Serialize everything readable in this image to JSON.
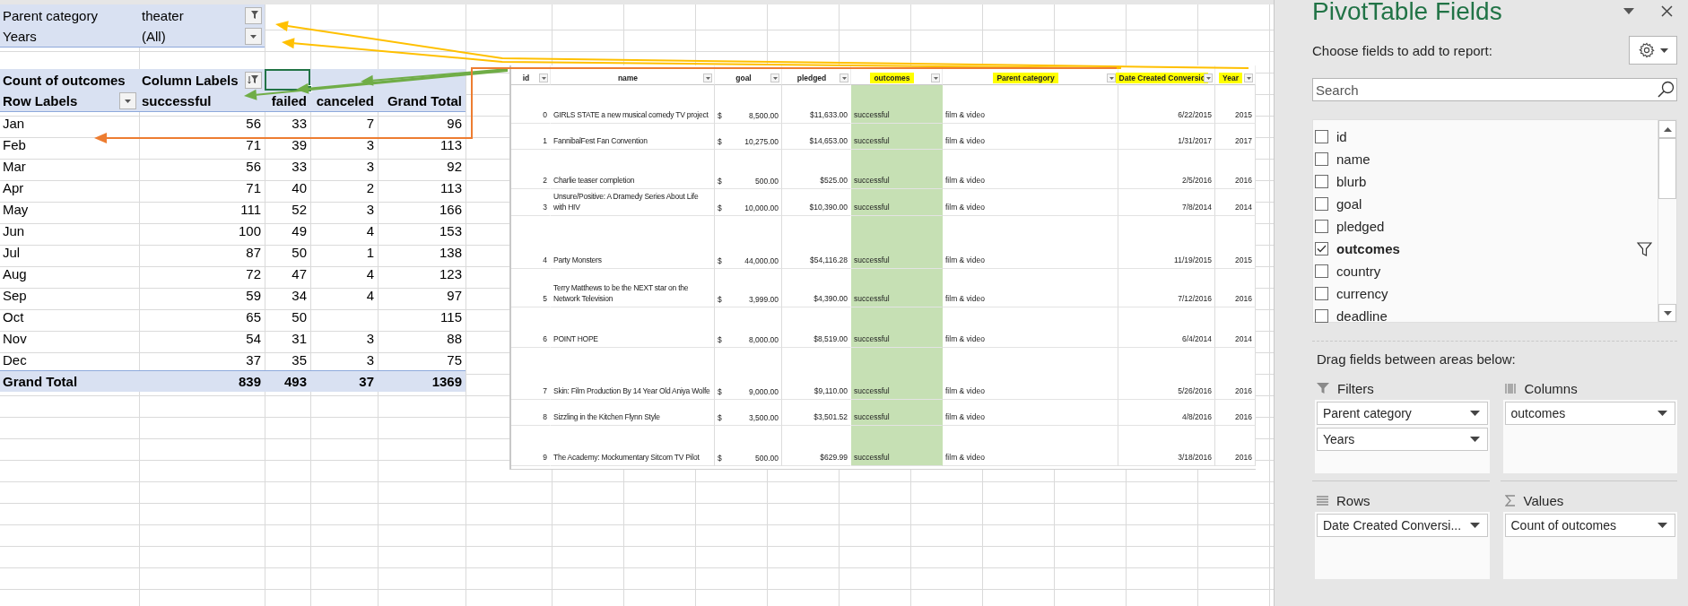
{
  "pivot": {
    "filters": [
      {
        "label": "Parent category",
        "value": "theater",
        "filtered": true
      },
      {
        "label": "Years",
        "value": "(All)",
        "filtered": false
      }
    ],
    "values_label": "Count of outcomes",
    "columns_label": "Column Labels",
    "columns_filtered": true,
    "row_labels": "Row Labels",
    "columns": [
      "successful",
      "failed",
      "canceled",
      "Grand Total"
    ],
    "rows": [
      {
        "label": "Jan",
        "successful": "56",
        "failed": "33",
        "canceled": "7",
        "grand_total": "96"
      },
      {
        "label": "Feb",
        "successful": "71",
        "failed": "39",
        "canceled": "3",
        "grand_total": "113"
      },
      {
        "label": "Mar",
        "successful": "56",
        "failed": "33",
        "canceled": "3",
        "grand_total": "92"
      },
      {
        "label": "Apr",
        "successful": "71",
        "failed": "40",
        "canceled": "2",
        "grand_total": "113"
      },
      {
        "label": "May",
        "successful": "111",
        "failed": "52",
        "canceled": "3",
        "grand_total": "166"
      },
      {
        "label": "Jun",
        "successful": "100",
        "failed": "49",
        "canceled": "4",
        "grand_total": "153"
      },
      {
        "label": "Jul",
        "successful": "87",
        "failed": "50",
        "canceled": "1",
        "grand_total": "138"
      },
      {
        "label": "Aug",
        "successful": "72",
        "failed": "47",
        "canceled": "4",
        "grand_total": "123"
      },
      {
        "label": "Sep",
        "successful": "59",
        "failed": "34",
        "canceled": "4",
        "grand_total": "97"
      },
      {
        "label": "Oct",
        "successful": "65",
        "failed": "50",
        "grand_total": "115"
      },
      {
        "label": "Nov",
        "successful": "54",
        "failed": "31",
        "canceled": "3",
        "grand_total": "88"
      },
      {
        "label": "Dec",
        "successful": "37",
        "failed": "35",
        "canceled": "3",
        "grand_total": "75"
      }
    ],
    "grand_total": {
      "label": "Grand Total",
      "successful": "839",
      "failed": "493",
      "canceled": "37",
      "grand_total": "1369"
    }
  },
  "source_table": {
    "columns": [
      {
        "label": "id",
        "highlighted": false
      },
      {
        "label": "name",
        "highlighted": false
      },
      {
        "label": "goal",
        "highlighted": false
      },
      {
        "label": "pledged",
        "highlighted": false
      },
      {
        "label": "outcomes",
        "highlighted": true
      },
      {
        "label": "Parent category",
        "highlighted": true
      },
      {
        "label": "Date Created Conversic",
        "highlighted": true
      },
      {
        "label": "Year",
        "highlighted": true
      }
    ],
    "rows": [
      {
        "id": "0",
        "name": "GIRLS STATE a new musical comedy TV project",
        "currency": "$",
        "goal": "8,500.00",
        "pledged": "$11,633.00",
        "outcome": "successful",
        "parent_category": "film & video",
        "date": "6/22/2015",
        "year": "2015"
      },
      {
        "id": "1",
        "name": "FannibalFest Fan Convention",
        "currency": "$",
        "goal": "10,275.00",
        "pledged": "$14,653.00",
        "outcome": "successful",
        "parent_category": "film & video",
        "date": "1/31/2017",
        "year": "2017"
      },
      {
        "id": "2",
        "name": "Charlie teaser completion",
        "currency": "$",
        "goal": "500.00",
        "pledged": "$525.00",
        "outcome": "successful",
        "parent_category": "film & video",
        "date": "2/5/2016",
        "year": "2016"
      },
      {
        "id": "3",
        "name": "Unsure/Positive: A Dramedy Series About Life with HIV",
        "currency": "$",
        "goal": "10,000.00",
        "pledged": "$10,390.00",
        "outcome": "successful",
        "parent_category": "film & video",
        "date": "7/8/2014",
        "year": "2014"
      },
      {
        "id": "4",
        "name": "Party Monsters",
        "currency": "$",
        "goal": "44,000.00",
        "pledged": "$54,116.28",
        "outcome": "successful",
        "parent_category": "film & video",
        "date": "11/19/2015",
        "year": "2015"
      },
      {
        "id": "5",
        "name": "Terry Matthews to be the NEXT star on the Network Television",
        "currency": "$",
        "goal": "3,999.00",
        "pledged": "$4,390.00",
        "outcome": "successful",
        "parent_category": "film & video",
        "date": "7/12/2016",
        "year": "2016"
      },
      {
        "id": "6",
        "name": "POINT HOPE",
        "currency": "$",
        "goal": "8,000.00",
        "pledged": "$8,519.00",
        "outcome": "successful",
        "parent_category": "film & video",
        "date": "6/4/2014",
        "year": "2014"
      },
      {
        "id": "7",
        "name": "Skin: Film Production By 14 Year Old Aniya Wolfe",
        "currency": "$",
        "goal": "9,000.00",
        "pledged": "$9,110.00",
        "outcome": "successful",
        "parent_category": "film & video",
        "date": "5/26/2016",
        "year": "2016"
      },
      {
        "id": "8",
        "name": "Sizzling in the Kitchen Flynn Style",
        "currency": "$",
        "goal": "3,500.00",
        "pledged": "$3,501.52",
        "outcome": "successful",
        "parent_category": "film & video",
        "date": "4/8/2016",
        "year": "2016"
      },
      {
        "id": "9",
        "name": "The Academy: Mockumentary Sitcom TV Pilot",
        "currency": "$",
        "goal": "500.00",
        "pledged": "$629.99",
        "outcome": "successful",
        "parent_category": "film & video",
        "date": "3/18/2016",
        "year": "2016"
      }
    ]
  },
  "field_pane": {
    "title": "PivotTable Fields",
    "choose_label": "Choose fields to add to report:",
    "search": {
      "placeholder": "Search"
    },
    "fields": [
      {
        "label": "id",
        "checked": false,
        "filtered": false
      },
      {
        "label": "name",
        "checked": false,
        "filtered": false
      },
      {
        "label": "blurb",
        "checked": false,
        "filtered": false
      },
      {
        "label": "goal",
        "checked": false,
        "filtered": false
      },
      {
        "label": "pledged",
        "checked": false,
        "filtered": false
      },
      {
        "label": "outcomes",
        "checked": true,
        "filtered": true
      },
      {
        "label": "country",
        "checked": false,
        "filtered": false
      },
      {
        "label": "currency",
        "checked": false,
        "filtered": false
      },
      {
        "label": "deadline",
        "checked": false,
        "filtered": false
      }
    ],
    "drag_label": "Drag fields between areas below:",
    "areas": [
      {
        "kind": "filters",
        "label": "Filters",
        "items": [
          "Parent category",
          "Years"
        ]
      },
      {
        "kind": "columns",
        "label": "Columns",
        "items": [
          "outcomes"
        ]
      },
      {
        "kind": "rows",
        "label": "Rows",
        "items": [
          "Date Created Conversi..."
        ]
      },
      {
        "kind": "values",
        "label": "Values",
        "items": [
          "Count of outcomes"
        ]
      }
    ]
  }
}
